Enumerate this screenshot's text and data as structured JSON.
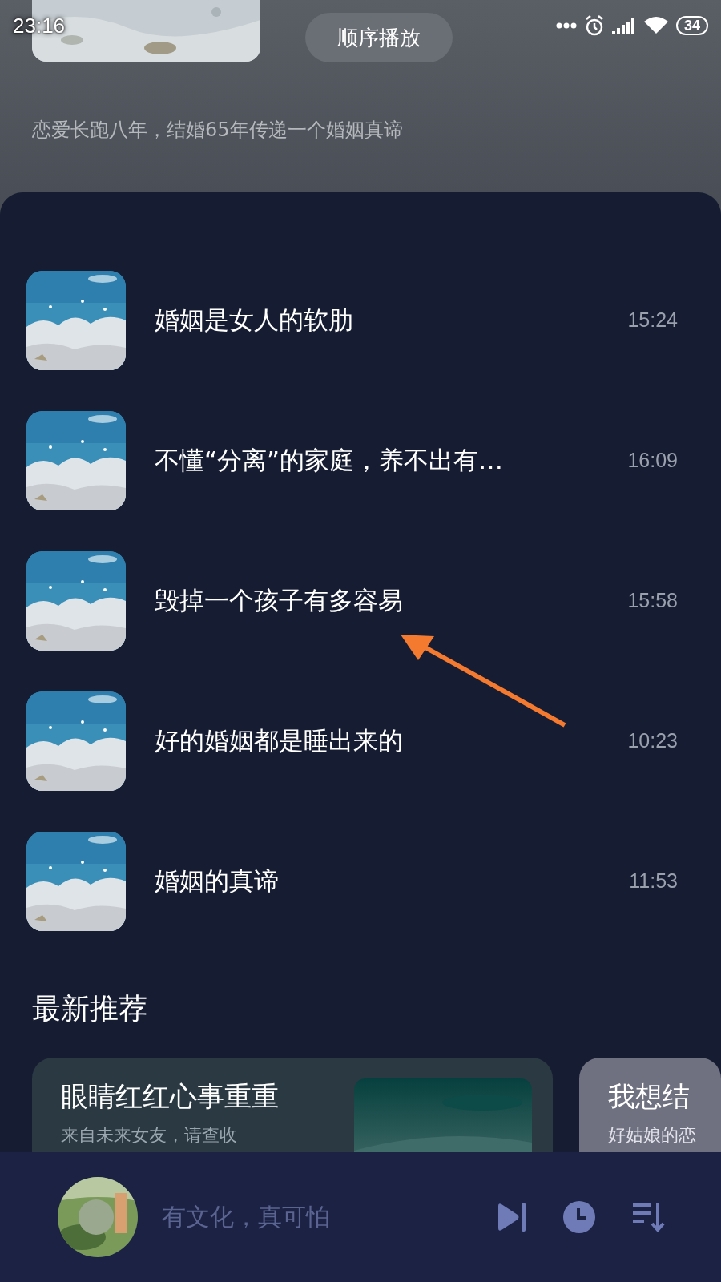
{
  "status_bar": {
    "time": "23:16",
    "battery": "34"
  },
  "header": {
    "play_mode_button": "顺序播放",
    "description": "恋爱长跑八年，结婚65年传递一个婚姻真谛"
  },
  "tracks": [
    {
      "title": "婚姻是女人的软肋",
      "duration": "15:24"
    },
    {
      "title": "不懂“分离”的家庭，养不出有…",
      "duration": "16:09"
    },
    {
      "title": "毁掉一个孩子有多容易",
      "duration": "15:58"
    },
    {
      "title": "好的婚姻都是睡出来的",
      "duration": "10:23"
    },
    {
      "title": "婚姻的真谛",
      "duration": "11:53"
    }
  ],
  "recommend": {
    "heading": "最新推荐",
    "cards": [
      {
        "title": "眼睛红红心事重重",
        "subtitle": "来自未来女友，请查收",
        "kind": "picture"
      },
      {
        "title": "我想结",
        "subtitle": "好姑娘的恋"
      }
    ]
  },
  "player": {
    "now_playing": "有文化，真可怕"
  }
}
